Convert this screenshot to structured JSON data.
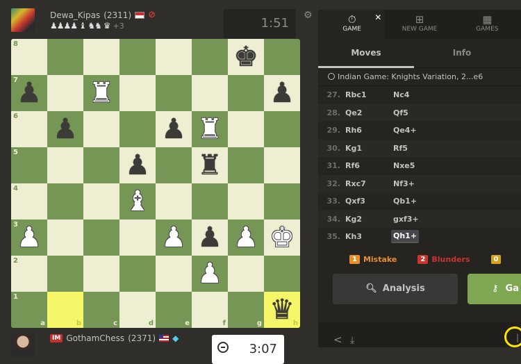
{
  "top_player": {
    "username": "Dewa_Kipas",
    "rating": "(2311)",
    "flag": "Indonesia",
    "status_icon": "ban-icon",
    "captured_pieces": "♟♟♟♟ ♝ ♞♞ ♛",
    "material_advantage": "+3",
    "clock": "1:51"
  },
  "bottom_player": {
    "title": "IM",
    "username": "GothamChess",
    "rating": "(2371)",
    "flag": "United States",
    "membership_icon": "diamond-icon",
    "clock": "3:07"
  },
  "board": {
    "ranks": [
      "8",
      "7",
      "6",
      "5",
      "4",
      "3",
      "2",
      "1"
    ],
    "files": [
      "a",
      "b",
      "c",
      "d",
      "e",
      "f",
      "g",
      "h"
    ],
    "highlighted_squares": [
      "b1",
      "h1"
    ],
    "pieces": {
      "g8": "bk",
      "a7": "bp",
      "c7": "wr",
      "h7": "bp",
      "b6": "bp",
      "e6": "bp",
      "f6": "wr",
      "d5": "bp",
      "f5": "br",
      "d4": "wb",
      "a3": "wp",
      "e3": "wp",
      "f3": "bp",
      "g3": "wp",
      "h3": "wk",
      "f2": "wp",
      "h1": "bq"
    },
    "colors": {
      "light": "#eeeed2",
      "dark": "#769656",
      "highlight": "#f6f669"
    }
  },
  "panel": {
    "nav_tabs": [
      {
        "label": "GAME",
        "icon": "stopwatch-icon",
        "active": true
      },
      {
        "label": "NEW GAME",
        "icon": "plus-square-icon",
        "active": false
      },
      {
        "label": "GAMES",
        "icon": "checkerboard-icon",
        "active": false
      }
    ],
    "close_label": "✕",
    "sub_tabs": [
      {
        "label": "Moves",
        "active": true
      },
      {
        "label": "Info",
        "active": false
      }
    ],
    "opening": "Indian Game: Knights Variation, 2...e6",
    "moves": [
      {
        "num": "27.",
        "white": "Rbc1",
        "black": "Nc4"
      },
      {
        "num": "28.",
        "white": "Qe2",
        "black": "Qf5"
      },
      {
        "num": "29.",
        "white": "Rh6",
        "black": "Qe4+"
      },
      {
        "num": "30.",
        "white": "Kg1",
        "black": "Rf5"
      },
      {
        "num": "31.",
        "white": "Rf6",
        "black": "Nxe5"
      },
      {
        "num": "32.",
        "white": "Rxc7",
        "black": "Nf3+"
      },
      {
        "num": "33.",
        "white": "Qxf3",
        "black": "Qb1+"
      },
      {
        "num": "34.",
        "white": "Kg2",
        "black": "gxf3+"
      },
      {
        "num": "35.",
        "white": "Kh3",
        "black": "Qh1+"
      }
    ],
    "current_move": "Qh1+",
    "stats": [
      {
        "count": "1",
        "label": "Mistake",
        "color": "#e58f2a"
      },
      {
        "count": "2",
        "label": "Blunders",
        "color": "#ca3431"
      },
      {
        "count": "0",
        "label": "",
        "color": "#d9a21b"
      }
    ],
    "analysis_button": "Analysis",
    "review_button": "Ga"
  }
}
